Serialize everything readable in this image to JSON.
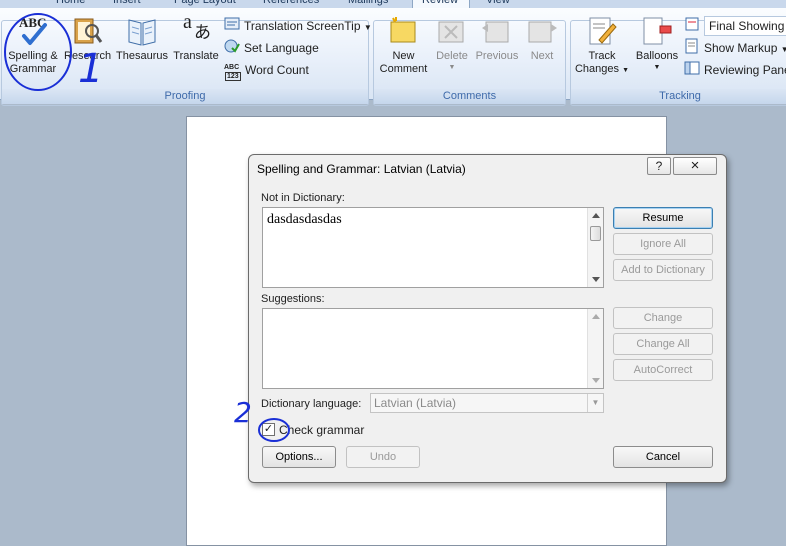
{
  "tabs": [
    "Home",
    "Insert",
    "Page Layout",
    "References",
    "Mailings",
    "Review",
    "View"
  ],
  "proofing": {
    "group_label": "Proofing",
    "spelling_line1": "Spelling &",
    "spelling_line2": "Grammar",
    "spelling_icon_text": "ABC",
    "research": "Research",
    "thesaurus": "Thesaurus",
    "translate": "Translate",
    "translation_screentip": "Translation ScreenTip",
    "set_language": "Set Language",
    "word_count": "Word Count",
    "word_count_icon_top": "ABC",
    "word_count_icon_bottom": "123"
  },
  "comments": {
    "group_label": "Comments",
    "new_line1": "New",
    "new_line2": "Comment",
    "delete": "Delete",
    "previous": "Previous",
    "next": "Next"
  },
  "tracking": {
    "group_label": "Tracking",
    "track_line1": "Track",
    "track_line2": "Changes",
    "balloons": "Balloons",
    "final_showing": "Final Showing",
    "show_markup": "Show Markup",
    "reviewing_pane": "Reviewing Pane"
  },
  "dialog": {
    "title": "Spelling and Grammar: Latvian (Latvia)",
    "help": "?",
    "close": "×",
    "not_in_dictionary_label": "Not in Dictionary:",
    "not_in_dictionary_text": "dasdasdasdas",
    "suggestions_label": "Suggestions:",
    "dictionary_language_label": "Dictionary language:",
    "dictionary_language_value": "Latvian (Latvia)",
    "check_grammar_label": "Check grammar",
    "check_grammar_checked": true,
    "buttons": {
      "resume": "Resume",
      "ignore_all": "Ignore All",
      "add_to_dictionary": "Add to Dictionary",
      "change": "Change",
      "change_all": "Change All",
      "autocorrect": "AutoCorrect",
      "options": "Options...",
      "undo": "Undo",
      "cancel": "Cancel"
    }
  },
  "annotations": {
    "mark1": "1",
    "mark2": "2",
    "ink_color": "#1a2fd6"
  },
  "colors": {
    "ribbon_group_label": "#3e6aaa",
    "workspace": "#abbacb",
    "dialog_bg": "#f0f0f0"
  }
}
